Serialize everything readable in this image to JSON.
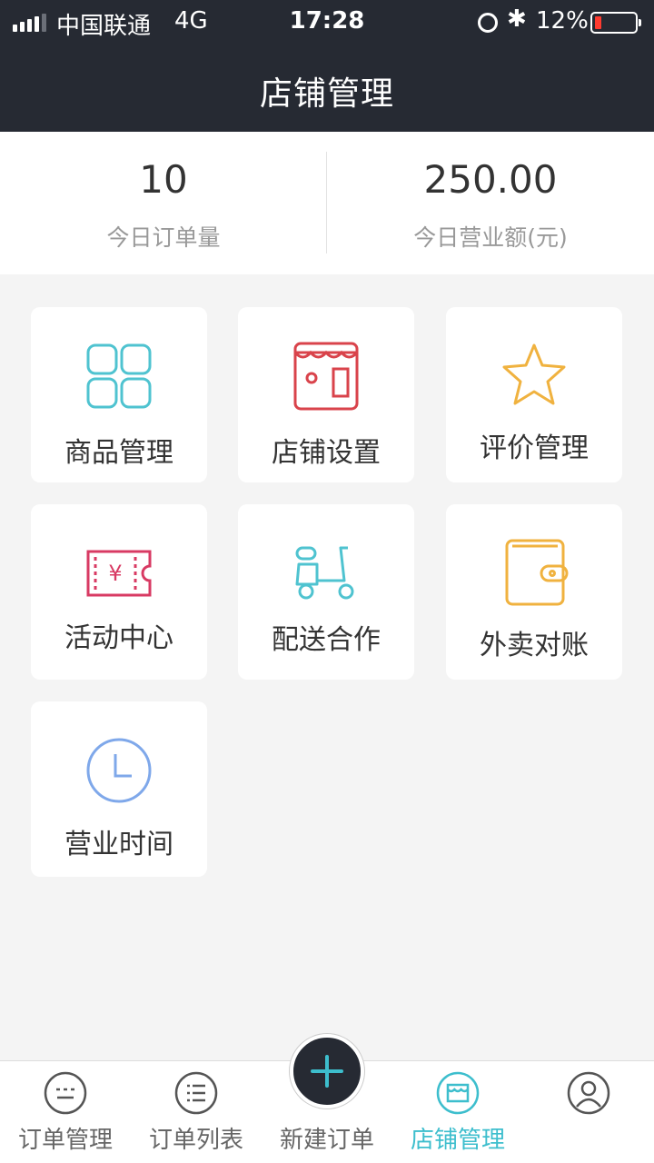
{
  "status_bar": {
    "carrier": "中国联通",
    "network": "4G",
    "time": "17:28",
    "battery": "12%",
    "bluetooth_glyph": "✱"
  },
  "header": {
    "title": "店铺管理"
  },
  "stats": [
    {
      "value": "10",
      "label": "今日订单量"
    },
    {
      "value": "250.00",
      "label": "今日营业额(元)"
    }
  ],
  "tiles": [
    {
      "label": "商品管理",
      "icon": "grid-icon",
      "color": "#4fc3d0"
    },
    {
      "label": "店铺设置",
      "icon": "storefront-icon",
      "color": "#d9434b"
    },
    {
      "label": "评价管理",
      "icon": "star-icon",
      "color": "#f0b23f"
    },
    {
      "label": "活动中心",
      "icon": "coupon-icon",
      "color": "#d83a63",
      "icon_text": "¥"
    },
    {
      "label": "配送合作",
      "icon": "scooter-icon",
      "color": "#4fc3d0"
    },
    {
      "label": "外卖对账",
      "icon": "wallet-icon",
      "color": "#f0b23f"
    },
    {
      "label": "营业时间",
      "icon": "clock-icon",
      "color": "#7fa8ea"
    }
  ],
  "tabbar": {
    "items": [
      {
        "label": "订单管理",
        "icon": "chat-dots-icon",
        "active": false
      },
      {
        "label": "订单列表",
        "icon": "list-icon",
        "active": false
      },
      {
        "label": "新建订单",
        "icon": "plus-icon",
        "active": false
      },
      {
        "label": "店铺管理",
        "icon": "store-icon",
        "active": true
      },
      {
        "label": "",
        "icon": "user-icon",
        "active": false
      }
    ],
    "fab_icon": "plus-icon",
    "accent": "#3dbecd"
  }
}
